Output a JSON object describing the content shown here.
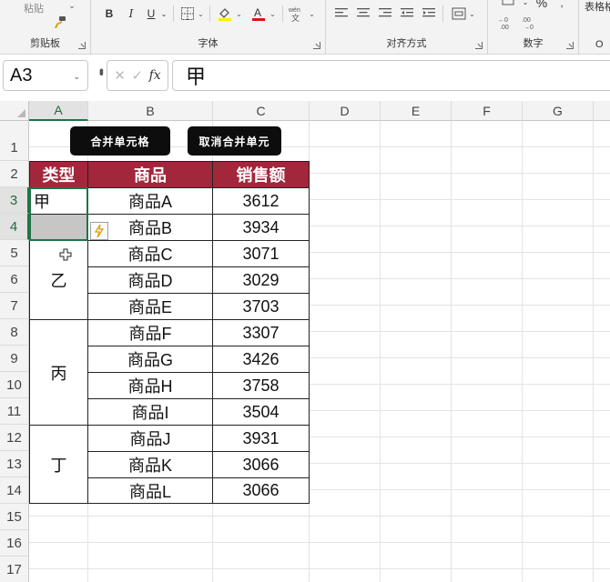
{
  "ribbon": {
    "clipboard": {
      "paste_label": "粘贴",
      "group_label": "剪贴板"
    },
    "font": {
      "group_label": "字体",
      "bold": "B",
      "italic": "I",
      "underline": "U",
      "phonetic": "wén"
    },
    "alignment": {
      "group_label": "对齐方式"
    },
    "number": {
      "group_label": "数字",
      "percent": "%"
    },
    "styles": {
      "group_label": "O",
      "table_format_label": "表格格"
    }
  },
  "formula_bar": {
    "name_box": "A3",
    "fx_label": "fx",
    "content": "甲"
  },
  "columns": [
    "A",
    "B",
    "C",
    "D",
    "E",
    "F",
    "G"
  ],
  "rows": [
    "1",
    "2",
    "3",
    "4",
    "5",
    "6",
    "7",
    "8",
    "9",
    "10",
    "11",
    "12",
    "13",
    "14",
    "15",
    "16",
    "17"
  ],
  "buttons": {
    "merge": "合并单元格",
    "unmerge": "取消合并单元"
  },
  "table": {
    "headers": {
      "type": "类型",
      "product": "商品",
      "sales": "销售额"
    },
    "groups": [
      {
        "type": "甲",
        "rows": [
          {
            "product": "商品A",
            "sales": "3612"
          }
        ]
      },
      {
        "type": "",
        "rows": [
          {
            "product": "商品B",
            "sales": "3934"
          }
        ]
      },
      {
        "type": "乙",
        "rows": [
          {
            "product": "商品C",
            "sales": "3071"
          },
          {
            "product": "商品D",
            "sales": "3029"
          },
          {
            "product": "商品E",
            "sales": "3703"
          }
        ]
      },
      {
        "type": "丙",
        "rows": [
          {
            "product": "商品F",
            "sales": "3307"
          },
          {
            "product": "商品G",
            "sales": "3426"
          },
          {
            "product": "商品H",
            "sales": "3758"
          },
          {
            "product": "商品I",
            "sales": "3504"
          }
        ]
      },
      {
        "type": "丁",
        "rows": [
          {
            "product": "商品J",
            "sales": "3931"
          },
          {
            "product": "商品K",
            "sales": "3066"
          },
          {
            "product": "商品L",
            "sales": "3066"
          }
        ]
      }
    ]
  },
  "colors": {
    "header_fill": "#a2273b",
    "selection": "#217346",
    "button_fill": "#0d0d0d"
  }
}
